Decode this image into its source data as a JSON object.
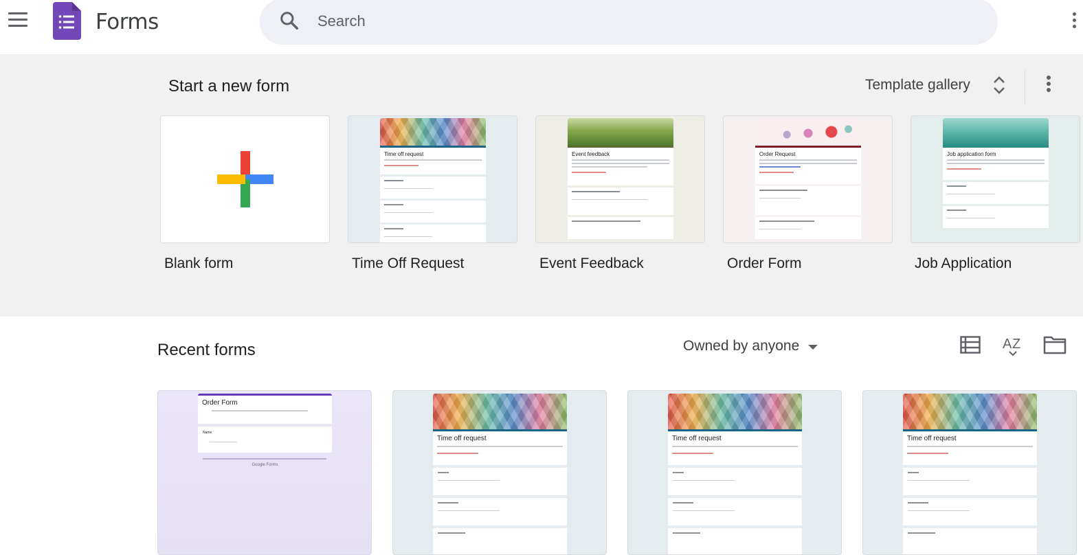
{
  "header": {
    "app_title": "Forms",
    "search_placeholder": "Search"
  },
  "templates": {
    "section_title": "Start a new form",
    "gallery_label": "Template gallery",
    "items": [
      {
        "label": "Blank form"
      },
      {
        "label": "Time Off Request",
        "thumb_title": "Time off request"
      },
      {
        "label": "Event Feedback",
        "thumb_title": "Event feedback"
      },
      {
        "label": "Order Form",
        "thumb_title": "Order Request"
      },
      {
        "label": "Job Application",
        "thumb_title": "Job application form"
      }
    ]
  },
  "recent": {
    "section_title": "Recent forms",
    "owner_filter": "Owned by anyone",
    "cards": [
      {
        "thumb_title": "Order Form",
        "field": "Name",
        "footer": "Google Forms"
      },
      {
        "thumb_title": "Time off request"
      },
      {
        "thumb_title": "Time off request"
      },
      {
        "thumb_title": "Time off request"
      }
    ]
  },
  "colors": {
    "forms_purple": "#7248b9",
    "search_bg": "#eef0f5",
    "band_bg": "#f1f1f1"
  }
}
